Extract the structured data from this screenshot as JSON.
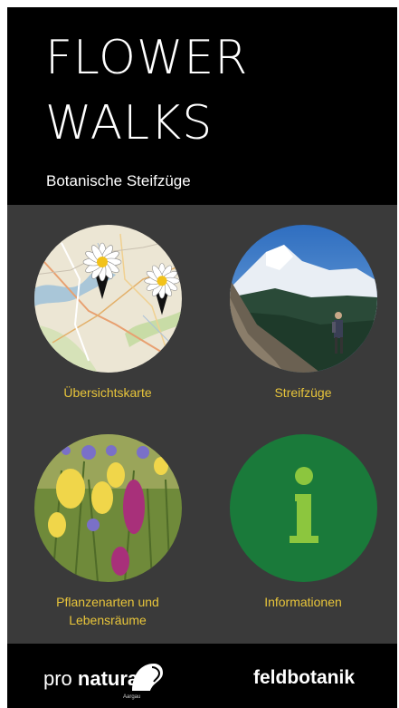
{
  "header": {
    "title_line1": "FLOWER",
    "title_line2": "WALKS",
    "subtitle": "Botanische Steifzüge"
  },
  "tiles": [
    {
      "label": "Übersichtskarte"
    },
    {
      "label": "Streifzüge"
    },
    {
      "label_line1": "Pflanzenarten und",
      "label_line2": "Lebensräume"
    },
    {
      "label": "Informationen"
    }
  ],
  "footer": {
    "pro_natura_pre": "pro ",
    "pro_natura_bold": "natura",
    "pro_natura_sub": "Aargau",
    "feldbotanik": "feldbotanik"
  },
  "colors": {
    "accent_label": "#e8c53a",
    "info_circle": "#1a7a3a",
    "info_glyph": "#8cc63e",
    "panel_bg": "#3a3a3a"
  }
}
